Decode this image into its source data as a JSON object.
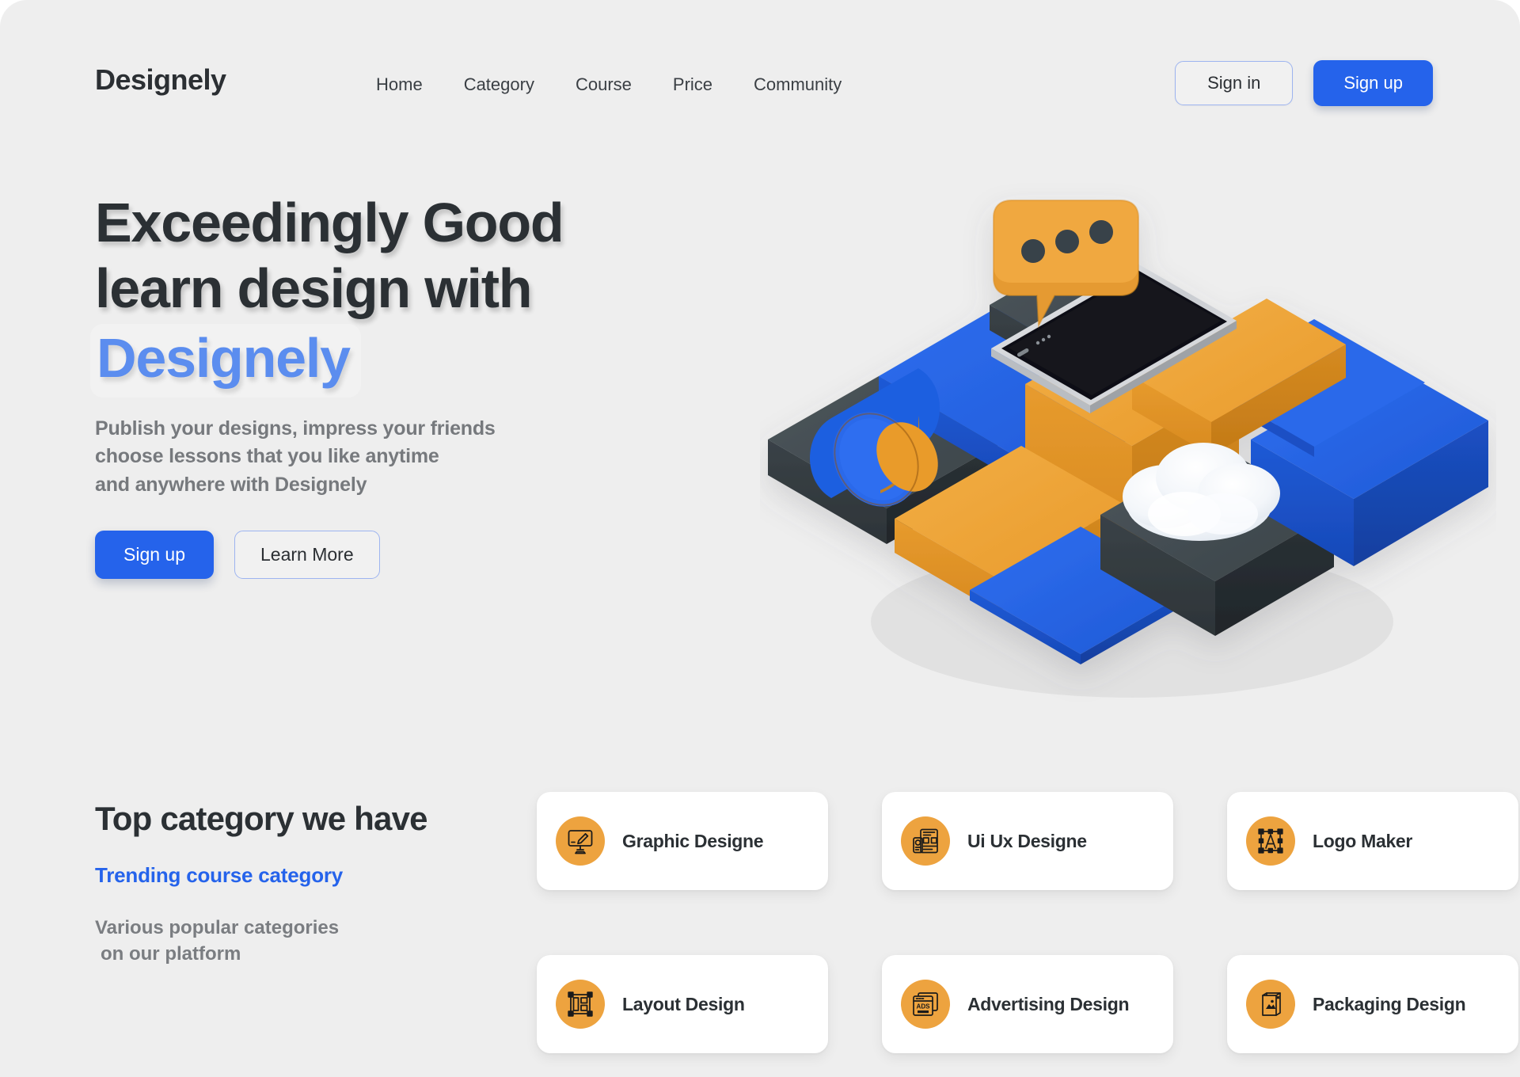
{
  "brand": "Designely",
  "nav": {
    "items": [
      {
        "label": "Home",
        "name": "nav-home"
      },
      {
        "label": "Category",
        "name": "nav-category"
      },
      {
        "label": "Course",
        "name": "nav-course"
      },
      {
        "label": "Price",
        "name": "nav-price"
      },
      {
        "label": "Community",
        "name": "nav-community"
      }
    ]
  },
  "auth": {
    "sign_in": "Sign in",
    "sign_up": "Sign up"
  },
  "hero": {
    "headline_line1": "Exceedingly Good",
    "headline_line2": "learn design with",
    "headline_accent": "Designely",
    "sub_line1": "Publish your designs, impress your friends",
    "sub_line2": "choose lessons that you like anytime",
    "sub_line3": "and anywhere with Designely",
    "cta_primary": "Sign up",
    "cta_secondary": "Learn More",
    "illustration": "isometric-3d-platform-phone-chat-bubble-cloud"
  },
  "category": {
    "title": "Top category we have",
    "trending": "Trending course category",
    "desc_line1": "Various popular categories",
    "desc_line2": " on our platform",
    "cards": [
      {
        "label": "Graphic Designe",
        "icon": "monitor-paintbrush-icon"
      },
      {
        "label": "Ui Ux Designe",
        "icon": "wireframe-layout-icon"
      },
      {
        "label": "Logo Maker",
        "icon": "letter-a-frame-icon"
      },
      {
        "label": "Layout Design",
        "icon": "grid-frame-icon"
      },
      {
        "label": "Advertising Design",
        "icon": "ads-browser-icon"
      },
      {
        "label": "Packaging Design",
        "icon": "box-package-icon"
      }
    ]
  },
  "colors": {
    "background": "#eeeeee",
    "accent_blue": "#2563eb",
    "headline_accent_blue": "#5b8def",
    "icon_orange": "#eda33f",
    "text_dark": "#2b3034",
    "text_muted": "#7a7d81",
    "card_white": "#ffffff",
    "illus_blue": "#1f5fe0",
    "illus_orange": "#eca033",
    "illus_dark": "#3a4247"
  }
}
